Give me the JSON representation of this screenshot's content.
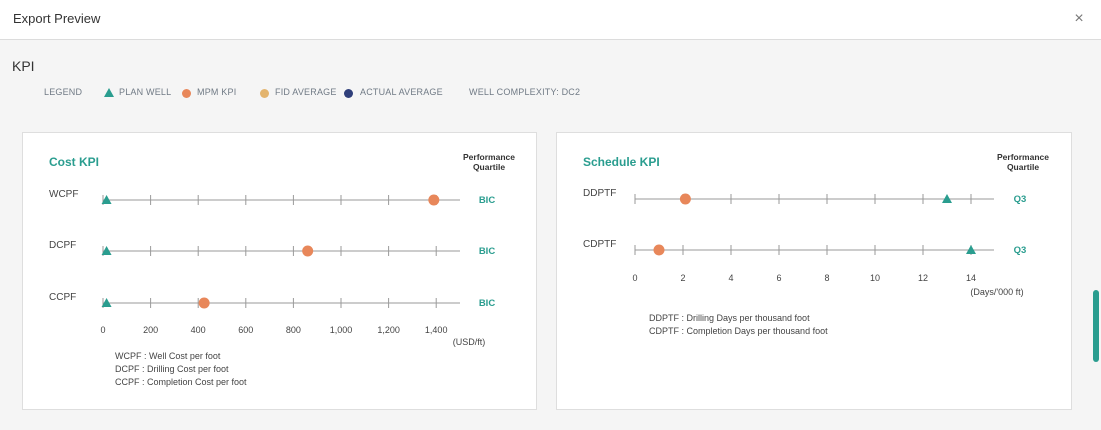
{
  "header": {
    "title": "Export Preview",
    "close_symbol": "×"
  },
  "section_title": "KPI",
  "legend": {
    "label": "LEGEND",
    "items": [
      {
        "label": "PLAN WELL",
        "shape": "triangle",
        "color": "#2a9d8f"
      },
      {
        "label": "MPM KPI",
        "shape": "circle",
        "color": "#e8875a"
      },
      {
        "label": "FID AVERAGE",
        "shape": "circle",
        "color": "#e3b46e"
      },
      {
        "label": "ACTUAL AVERAGE",
        "shape": "circle",
        "color": "#2f3f7a"
      }
    ],
    "complexity": "WELL COMPLEXITY: DC2"
  },
  "colors": {
    "accent": "#2a9d8f",
    "mpm": "#e8875a",
    "axis": "#9a9a9a",
    "label": "#444444"
  },
  "panels": {
    "cost": {
      "title": "Cost KPI",
      "quartile_header": [
        "Performance",
        "Quartile"
      ]
    },
    "schedule": {
      "title": "Schedule KPI",
      "quartile_header": [
        "Performance",
        "Quartile"
      ]
    }
  },
  "chart_data": [
    {
      "type": "scatter",
      "title": "Cost KPI",
      "xlim": [
        0,
        1500
      ],
      "ticks": [
        0,
        200,
        400,
        600,
        800,
        1000,
        1200,
        1400
      ],
      "tick_labels": [
        "0",
        "200",
        "400",
        "600",
        "800",
        "1,000",
        "1,200",
        "1,400"
      ],
      "unit": "(USD/ft)",
      "rows": [
        {
          "name": "WCPF",
          "plan_well": 15,
          "mpm_kpi": 1390,
          "quartile": "BIC"
        },
        {
          "name": "DCPF",
          "plan_well": 15,
          "mpm_kpi": 860,
          "quartile": "BIC"
        },
        {
          "name": "CCPF",
          "plan_well": 15,
          "mpm_kpi": 425,
          "quartile": "BIC"
        }
      ],
      "definitions": [
        "WCPF : Well Cost per foot",
        "DCPF : Drilling Cost per foot",
        "CCPF : Completion Cost per foot"
      ]
    },
    {
      "type": "scatter",
      "title": "Schedule KPI",
      "xlim": [
        0,
        15
      ],
      "ticks": [
        0,
        2,
        4,
        6,
        8,
        10,
        12,
        14
      ],
      "tick_labels": [
        "0",
        "2",
        "4",
        "6",
        "8",
        "10",
        "12",
        "14"
      ],
      "unit": "(Days/'000 ft)",
      "rows": [
        {
          "name": "DDPTF",
          "plan_well": 13,
          "mpm_kpi": 2.1,
          "quartile": "Q3"
        },
        {
          "name": "CDPTF",
          "plan_well": 14,
          "mpm_kpi": 1.0,
          "quartile": "Q3"
        }
      ],
      "definitions": [
        "DDPTF : Drilling Days per thousand foot",
        "CDPTF : Completion Days per thousand foot"
      ]
    }
  ]
}
